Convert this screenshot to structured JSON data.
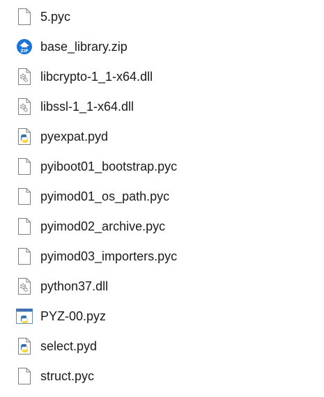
{
  "files": [
    {
      "name": "5.pyc",
      "icon": "blank-file-icon"
    },
    {
      "name": "base_library.zip",
      "icon": "zip-archive-icon"
    },
    {
      "name": "libcrypto-1_1-x64.dll",
      "icon": "dll-gear-file-icon"
    },
    {
      "name": "libssl-1_1-x64.dll",
      "icon": "dll-gear-file-icon"
    },
    {
      "name": "pyexpat.pyd",
      "icon": "python-file-icon"
    },
    {
      "name": "pyiboot01_bootstrap.pyc",
      "icon": "blank-file-icon"
    },
    {
      "name": "pyimod01_os_path.pyc",
      "icon": "blank-file-icon"
    },
    {
      "name": "pyimod02_archive.pyc",
      "icon": "blank-file-icon"
    },
    {
      "name": "pyimod03_importers.pyc",
      "icon": "blank-file-icon"
    },
    {
      "name": "python37.dll",
      "icon": "dll-gear-file-icon"
    },
    {
      "name": "PYZ-00.pyz",
      "icon": "python-window-icon"
    },
    {
      "name": "select.pyd",
      "icon": "python-file-icon"
    },
    {
      "name": "struct.pyc",
      "icon": "blank-file-icon"
    }
  ],
  "colors": {
    "zip_blue": "#1a73d9",
    "python_blue": "#3775a9",
    "python_yellow": "#ffd43b",
    "gear_gray": "#8a8a8a"
  }
}
